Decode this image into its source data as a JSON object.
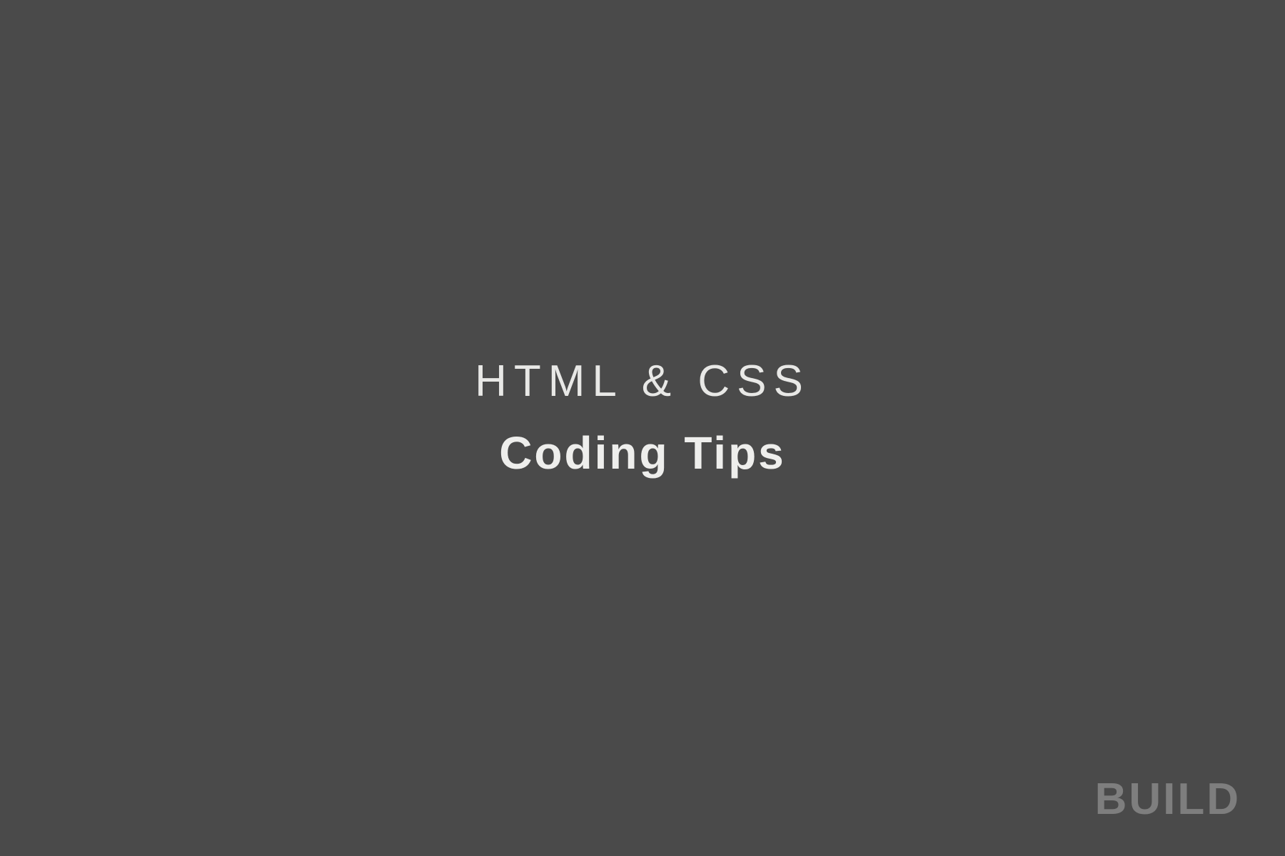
{
  "slide": {
    "heading_top": "HTML & CSS",
    "heading_bottom": "Coding Tips"
  },
  "footer": {
    "brand": "BUILD"
  },
  "colors": {
    "background": "#4a4a4a",
    "text_primary": "#eeeeec",
    "text_muted": "rgba(230,230,230,0.34)"
  }
}
